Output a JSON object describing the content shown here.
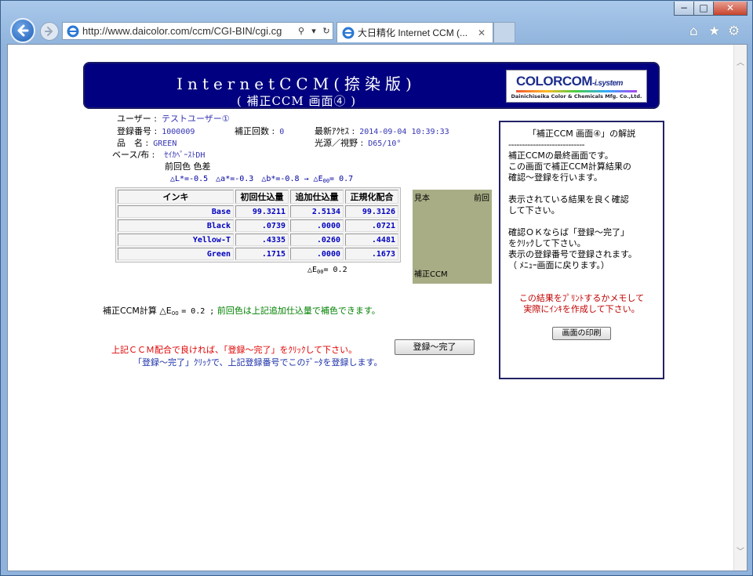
{
  "browser": {
    "url": "http://www.daicolor.com/ccm/CGI-BIN/cgi.cg",
    "tab_title": "大日精化 Internet CCM (...",
    "window_buttons": {
      "minimize": "−",
      "maximize": "□",
      "close": "✕"
    }
  },
  "header": {
    "title": "InternetCCM(捺染版)",
    "subtitle": "( 補正CCM 画面④ )",
    "logo_main": "COLORCOM",
    "logo_suffix": "-i.system",
    "logo_company": "Dainichiseika Color & Chemicals Mfg. Co.,Ltd."
  },
  "info": {
    "user_label": "ユーザー :",
    "user_value": "テストユーザー①",
    "reg_label": "登録番号 :",
    "reg_value": "1000009",
    "corr_label": "補正回数 :",
    "corr_value": "0",
    "access_label": "最新ｱｸｾｽ :",
    "access_value": "2014-09-04 10:39:33",
    "product_label": "品　名 :",
    "product_value": "GREEN",
    "light_label": "光源／視野 :",
    "light_value": "D65/10°",
    "base_label": "ベース/布 :",
    "base_value": "ｾｲｶﾍﾟｰｽﾄDH",
    "prev_diff_label": "前回色 色差",
    "delta_line": "△L*=-0.5　△a*=-0.3　△b*=-0.8 → △E",
    "delta_line_sub": "00",
    "delta_line_end": "= 0.7"
  },
  "table": {
    "headers": [
      "インキ",
      "初回仕込量",
      "追加仕込量",
      "正規化配合"
    ],
    "rows": [
      [
        "Base",
        "99.3211",
        "2.5134",
        "99.3126"
      ],
      [
        "Black",
        ".0739",
        ".0000",
        ".0721"
      ],
      [
        "Yellow-T",
        ".4335",
        ".0260",
        ".4481"
      ],
      [
        "Green",
        ".1715",
        ".0000",
        ".1673"
      ]
    ],
    "delta_e_prefix": "△E",
    "delta_e_sub": "00",
    "delta_e_value": "= 0.2"
  },
  "swatch": {
    "sample_label": "見本",
    "previous_label": "前回",
    "corrected_label": "補正CCM",
    "color": "#a8ad85"
  },
  "calc": {
    "prefix": "補正CCM計算 △E",
    "sub": "00",
    "value": "= 0.2 ;",
    "note": "前回色は上記追加仕込量で補色できます。"
  },
  "register": {
    "instruction": "上記ＣＣＭ配合で良ければ、「登録～完了」をｸﾘｯｸして下さい。",
    "button": "登録～完了",
    "note": "「登録～完了」ｸﾘｯｸで、上記登録番号でこのﾃﾞｰﾀを登録します。"
  },
  "help": {
    "title": "「補正CCM 画面④」の解説",
    "rule": "----------------------------",
    "p1a": "補正CCMの最終画面です。",
    "p1b": "この画面で補正CCM計算結果の",
    "p1c": "確認～登録を行います。",
    "p2a": "表示されている結果を良く確認",
    "p2b": "して下さい。",
    "p3a": "確認ＯＫならば「登録～完了」",
    "p3b": "をｸﾘｯｸして下さい。",
    "p3c": "表示の登録番号で登録されます。",
    "p3d": "（ ﾒﾆｭｰ画面に戻ります。）",
    "print_note_a": "この結果をﾌﾟﾘﾝﾄするかメモして",
    "print_note_b": "実際にｲﾝｷを作成して下さい。",
    "print_button": "画面の印刷"
  }
}
